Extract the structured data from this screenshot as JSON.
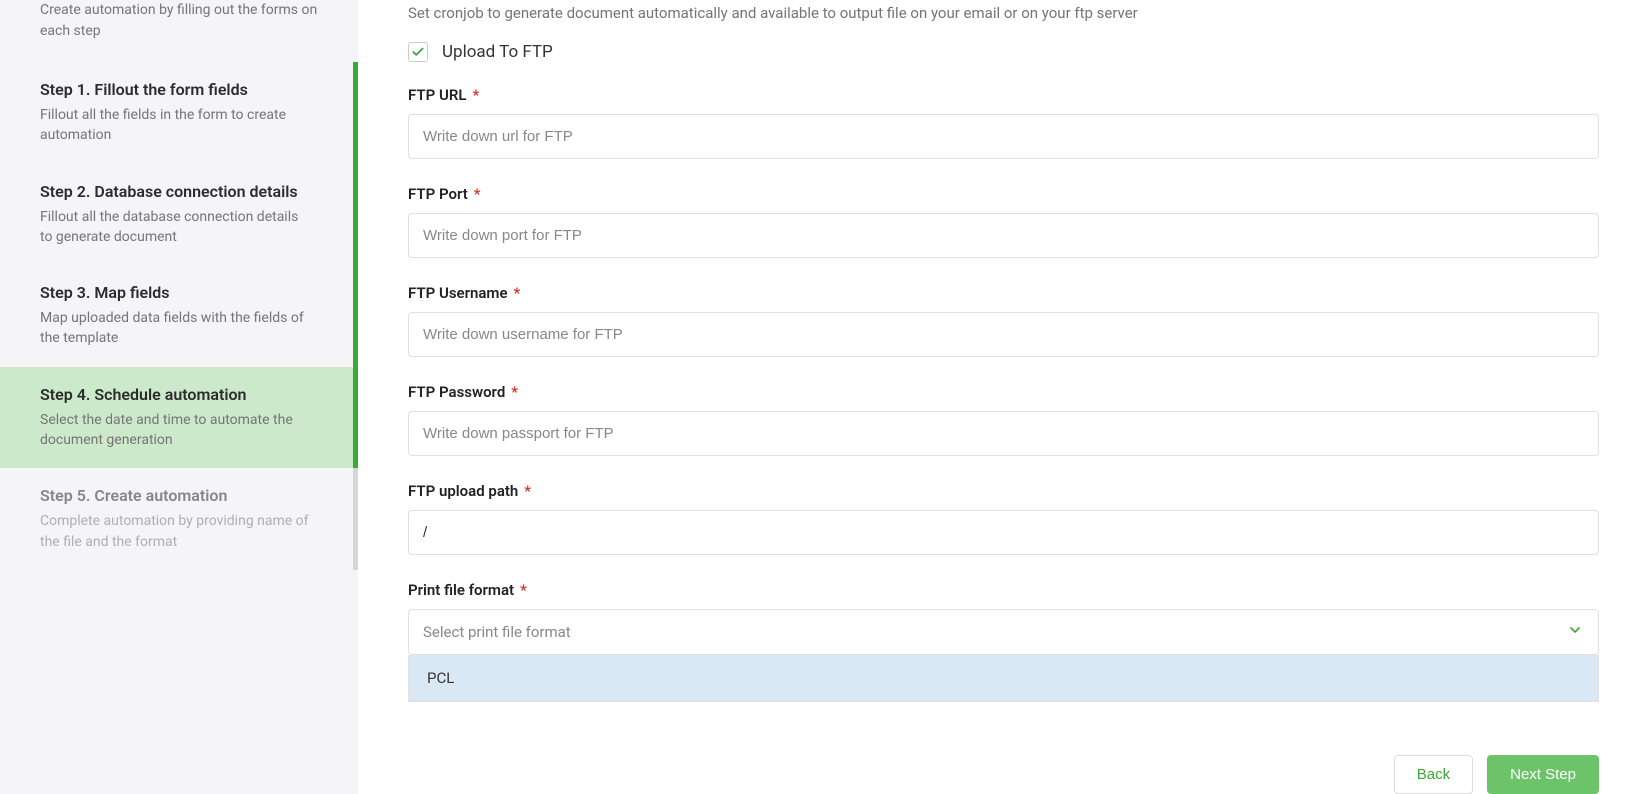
{
  "sidebar": {
    "intro": "Create automation by filling out the forms on each step",
    "steps": [
      {
        "title": "Step 1. Fillout the form fields",
        "desc": "Fillout all the fields in the form to create automation",
        "state": "done"
      },
      {
        "title": "Step 2. Database connection details",
        "desc": "Fillout all the database connection details to generate document",
        "state": "done"
      },
      {
        "title": "Step 3. Map fields",
        "desc": "Map uploaded data fields with the fields of the template",
        "state": "done"
      },
      {
        "title": "Step 4. Schedule automation",
        "desc": "Select the date and time to automate the document generation",
        "state": "active"
      },
      {
        "title": "Step 5. Create automation",
        "desc": "Complete automation by providing name of the file and the format",
        "state": "pending"
      }
    ]
  },
  "main": {
    "header": "Set cronjob to generate document automatically and available to output file on your email or on your ftp server",
    "upload_checkbox": {
      "label": "Upload To FTP",
      "checked": true
    },
    "fields": {
      "ftp_url": {
        "label": "FTP URL",
        "placeholder": "Write down url for FTP",
        "value": ""
      },
      "ftp_port": {
        "label": "FTP Port",
        "placeholder": "Write down port for FTP",
        "value": ""
      },
      "ftp_user": {
        "label": "FTP Username",
        "placeholder": "Write down username for FTP",
        "value": ""
      },
      "ftp_pass": {
        "label": "FTP Password",
        "placeholder": "Write down passport for FTP",
        "value": ""
      },
      "ftp_path": {
        "label": "FTP upload path",
        "placeholder": "",
        "value": "/"
      },
      "file_format": {
        "label": "Print file format",
        "placeholder": "Select print file format",
        "value": ""
      }
    },
    "dropdown_options": [
      "PCL"
    ],
    "required_mark": "*"
  },
  "footer": {
    "back": "Back",
    "next": "Next Step"
  }
}
